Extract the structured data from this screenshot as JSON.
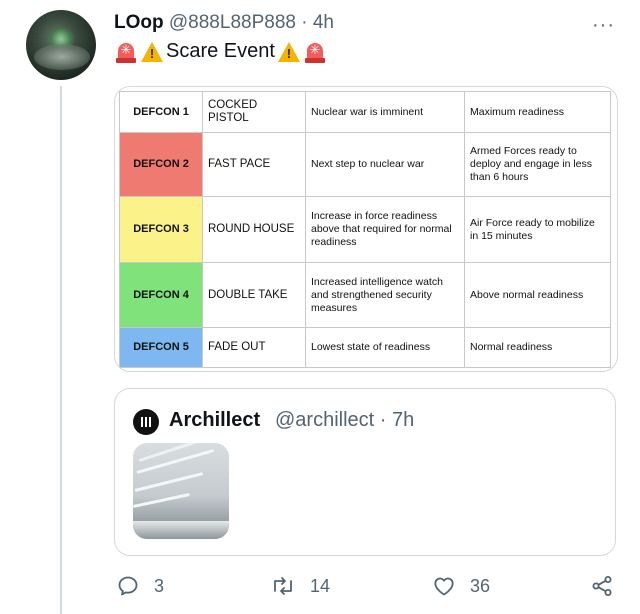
{
  "tweet": {
    "author_name": "LOop",
    "author_handle": "@888L88P888",
    "separator": "·",
    "time": "4h",
    "more_label": "···",
    "text": "Scare Event",
    "emoji": [
      "rotating-light-icon",
      "warning-icon",
      "warning-icon",
      "rotating-light-icon"
    ]
  },
  "defcon_table": {
    "rows": [
      {
        "level": "DEFCON 1",
        "code": "COCKED PISTOL",
        "description": "Nuclear war is imminent",
        "readiness": "Maximum readiness",
        "color": "#ffffff"
      },
      {
        "level": "DEFCON 2",
        "code": "FAST PACE",
        "description": "Next step to nuclear war",
        "readiness": "Armed Forces ready to deploy and engage in less than 6 hours",
        "color": "#ef7a72"
      },
      {
        "level": "DEFCON 3",
        "code": "ROUND HOUSE",
        "description": "Increase in force readiness above that required for normal readiness",
        "readiness": "Air Force ready to mobilize in 15 minutes",
        "color": "#fbf38a"
      },
      {
        "level": "DEFCON 4",
        "code": "DOUBLE TAKE",
        "description": "Increased intelligence watch and strengthened security measures",
        "readiness": "Above normal readiness",
        "color": "#7fe27a"
      },
      {
        "level": "DEFCON 5",
        "code": "FADE OUT",
        "description": "Lowest state of readiness",
        "readiness": "Normal readiness",
        "color": "#7db9f0"
      }
    ]
  },
  "quoted": {
    "author_name": "Archillect",
    "author_handle": "@archillect",
    "separator": "·",
    "time": "7h"
  },
  "actions": {
    "replies": "3",
    "retweets": "14",
    "likes": "36"
  },
  "colors": {
    "secondary_text": "#536471",
    "border": "#cfd9de"
  }
}
